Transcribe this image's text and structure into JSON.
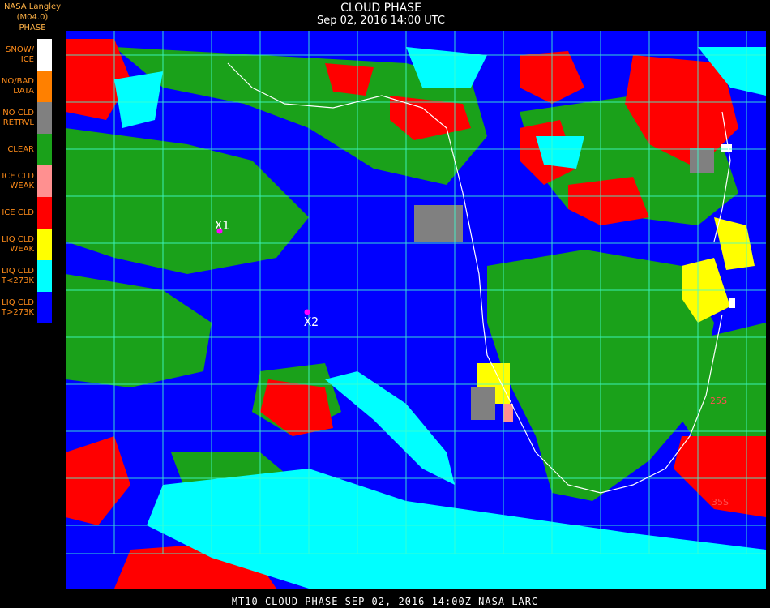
{
  "header": {
    "source": "NASA Langley (M04.0)",
    "legend_title": "PHASE",
    "title": "CLOUD PHASE",
    "datetime": "Sep 02, 2016 14:00 UTC"
  },
  "legend": [
    {
      "label": "SNOW/\nICE",
      "color": "#ffffff"
    },
    {
      "label": "NO/BAD\nDATA",
      "color": "#ff8000"
    },
    {
      "label": "NO CLD\nRETRVL",
      "color": "#808080"
    },
    {
      "label": "CLEAR",
      "color": "#1aa11a"
    },
    {
      "label": "ICE CLD\nWEAK",
      "color": "#ff9090"
    },
    {
      "label": "ICE CLD",
      "color": "#ff0000"
    },
    {
      "label": "LIQ CLD\nWEAK",
      "color": "#ffff00"
    },
    {
      "label": "LIQ CLD\nT<273K",
      "color": "#00ffff"
    },
    {
      "label": "LIQ CLD\nT>273K",
      "color": "#0000ff"
    }
  ],
  "markers": [
    {
      "label": "X1",
      "color": "#ff00ff"
    },
    {
      "label": "X2",
      "color": "#ff00ff"
    }
  ],
  "grid_labels": [
    "25S",
    "35S"
  ],
  "footer": "MT10  CLOUD PHASE   SEP 02, 2016 14:00Z   NASA LARC"
}
